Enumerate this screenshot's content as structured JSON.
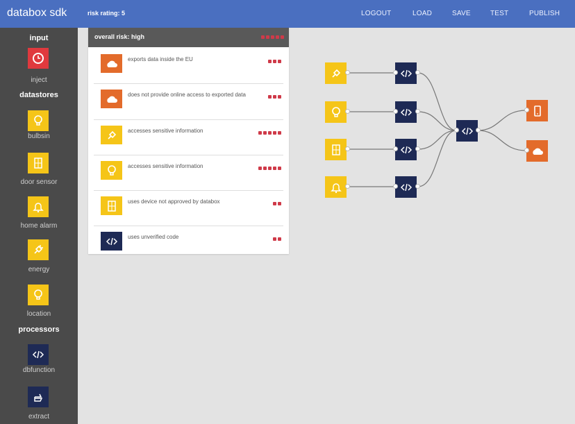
{
  "app": {
    "title": "databox sdk",
    "risk_rating": "risk rating: 5"
  },
  "menu": [
    "LOGOUT",
    "LOAD",
    "SAVE",
    "TEST",
    "PUBLISH"
  ],
  "sidebar": {
    "sections": {
      "input": "input",
      "datastores": "datastores",
      "processors": "processors"
    },
    "items": [
      {
        "label": "inject",
        "color": "#e0393e",
        "icon": "clock-icon"
      },
      {
        "label": "bulbsin",
        "color": "#f5c518",
        "icon": "bulb-icon"
      },
      {
        "label": "door sensor",
        "color": "#f5c518",
        "icon": "door-icon"
      },
      {
        "label": "home alarm",
        "color": "#f5c518",
        "icon": "bell-icon"
      },
      {
        "label": "energy",
        "color": "#f5c518",
        "icon": "plug-icon"
      },
      {
        "label": "location",
        "color": "#f5c518",
        "icon": "bulb-icon"
      },
      {
        "label": "dbfunction",
        "color": "#1e2a55",
        "icon": "code-icon"
      },
      {
        "label": "extract",
        "color": "#1e2a55",
        "icon": "hand-icon"
      }
    ]
  },
  "panel": {
    "title": "overall risk: high",
    "overall_risk_pips": 5,
    "risks": [
      {
        "text": "exports data inside the EU",
        "icon": "cloud-icon",
        "color": "#e36b2b",
        "pips": 3
      },
      {
        "text": "does not provide online access to exported data",
        "icon": "cloud-icon",
        "color": "#e36b2b",
        "pips": 3
      },
      {
        "text": "accesses sensitive information",
        "icon": "plug-icon",
        "color": "#f5c518",
        "pips": 5
      },
      {
        "text": "accesses sensitive information",
        "icon": "bulb-icon",
        "color": "#f5c518",
        "pips": 5
      },
      {
        "text": "uses device not approved by databox",
        "icon": "door-icon",
        "color": "#f5c518",
        "pips": 2
      },
      {
        "text": "uses unverified code",
        "icon": "code-icon",
        "color": "#1e2a55",
        "pips": 2
      }
    ]
  },
  "flow": {
    "nodes": [
      "plug-icon",
      "bulb-icon",
      "door-icon",
      "bell-icon",
      "code-icon",
      "code-icon",
      "code-icon",
      "code-icon",
      "code-icon",
      "phone-icon",
      "cloud-icon"
    ]
  }
}
